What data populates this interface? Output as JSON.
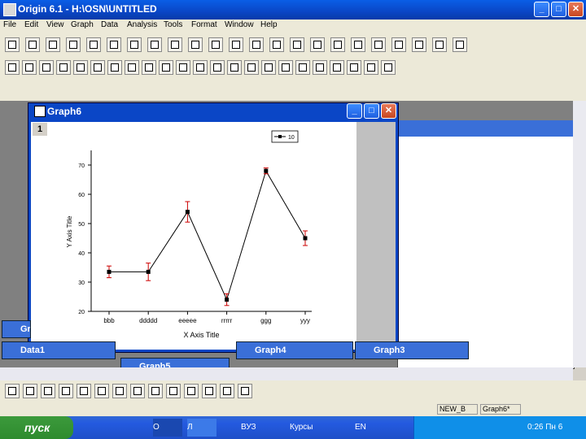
{
  "app": {
    "title": "Origin 6.1 - H:\\OSN\\UNTITLED",
    "min_label": "_",
    "max_label": "□",
    "close_label": "✕"
  },
  "menu": [
    "File",
    "Edit",
    "View",
    "Graph",
    "Data",
    "Analysis",
    "Tools",
    "Format",
    "Window",
    "Help"
  ],
  "toolbar1_icons": [
    "new-worksheet-icon",
    "new-graph-icon",
    "new-matrix-icon",
    "new-layout-icon",
    "new-excel-icon",
    "new-function-icon",
    "new-notes-icon",
    "open-icon",
    "open-template-icon",
    "save-project-icon",
    "save-template-icon",
    "import-ascii-icon",
    "import-multiple-icon",
    "print-icon",
    "duplicate-icon",
    "refresh-icon",
    "results-log-icon",
    "code-builder-icon",
    "script-window-icon",
    "project-explorer-icon",
    "command-window-icon",
    "copy-page-icon",
    "layer-icon"
  ],
  "toolbar2_icons": [
    "zoom-in-icon",
    "zoom-out-icon",
    "whole-page-icon",
    "rescale-icon",
    "add-layer-icon",
    "arrange-layers-icon",
    "layout-icon",
    "speed-mode-icon",
    "bring-front-icon",
    "send-back-icon",
    "clock-icon",
    "pointer-icon",
    "zoom-tool-icon",
    "screen-reader-icon",
    "data-reader-icon",
    "data-selector-icon",
    "draw-data-icon",
    "text-tool-icon",
    "arrow-tool-icon",
    "curved-arrow-icon",
    "line-tool-icon",
    "rectangle-tool-icon",
    "circle-tool-icon"
  ],
  "graph_window": {
    "title": "Graph6",
    "layer_label": "1"
  },
  "minimized_windows": [
    {
      "label": "Gr"
    },
    {
      "label": "Data1"
    },
    {
      "label": "Graph5"
    },
    {
      "label": "Graph4"
    },
    {
      "label": "Graph3"
    }
  ],
  "bottom_tool_icons": [
    "line-plot-icon",
    "scatter-plot-icon",
    "line-symbol-icon",
    "column-plot-icon",
    "bar-plot-icon",
    "pie-chart-icon",
    "area-plot-icon",
    "fill-area-icon",
    "polar-plot-icon",
    "ternary-plot-icon",
    "high-low-icon",
    "box-chart-icon",
    "vector-icon",
    "template-icon"
  ],
  "status": {
    "cell1": "NEW_B",
    "cell2": "Graph6*"
  },
  "taskbar": {
    "start_label": "пуск",
    "items": [
      "O",
      "Л",
      "ВУЗ",
      "Курсы"
    ],
    "lang": "EN",
    "clock": "0:26 Пн 6"
  },
  "chart_data": {
    "type": "line",
    "categories": [
      "bbb",
      "ddddd",
      "eeeee",
      "rrrrr",
      "ggg",
      "yyy"
    ],
    "values": [
      33.5,
      33.5,
      54,
      24,
      68,
      45
    ],
    "errors": [
      2,
      3,
      3.5,
      2,
      1,
      2.5
    ],
    "xlabel": "X Axis Title",
    "ylabel": "Y Axis Title",
    "ylim": [
      20,
      75
    ],
    "yticks": [
      20,
      30,
      40,
      50,
      60,
      70
    ],
    "ytick_labels": [
      "20",
      "30",
      "40",
      "50",
      "60",
      "70"
    ],
    "legend": "10",
    "legend_position": "top-right",
    "line_color": "#000000",
    "error_color": "#cc0000",
    "grid": false
  }
}
